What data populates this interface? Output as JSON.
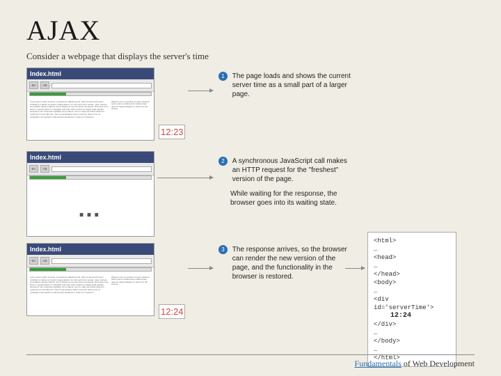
{
  "title": "AJAX",
  "subtitle": "Consider a webpage that displays the server's time",
  "browserTitle": "Index.html",
  "time1": "12:23",
  "time2": "12:24",
  "ellipsis": "…",
  "lorem": "Lorem ipsum dolor sit amet, consectetur adipiscing elit. Sed do eiusmod tempor incididunt ut labore et dolore magna aliqua. Ut enim ad minim veniam, quis nostrud exercitation ullamco laboris nisi ut aliquip ex ea commodo consequat. Duis aute irure dolor in reprehenderit in voluptate velit esse cillum dolore eu fugiat nulla pariatur. Excepteur sint occaecat cupidatat non proident, sunt in culpa qui officia deserunt mollit anim id est laborum. Sed ut perspiciatis unde omnis iste natus error sit voluptatem accusantium doloremque laudantium, totam rem aperiam.",
  "sidetext": "aliquam nunc sed tellus et lorem eleifend sed a purus condimentum ullamcorper quis ac magna aliquam et dolor nec elit viverra.",
  "callouts": {
    "c1": {
      "num": "1",
      "text": "The page loads and shows the current server time as a small part of a larger page."
    },
    "c2": {
      "num": "2",
      "text": "A synchronous JavaScript call makes an HTTP request for the \"freshest\" version of the page.",
      "sub": "While waiting for the response, the browser goes into its waiting state."
    },
    "c3": {
      "num": "3",
      "text": "The response arrives, so the browser can render the new version of the page, and the functionality in the browser is restored."
    }
  },
  "code": {
    "lines": [
      "<html>",
      "…",
      "<head>",
      "…",
      "</head>",
      "<body>",
      "…",
      "<div id='serverTime'>"
    ],
    "timeval": "12:24",
    "lines2": [
      "</div>",
      "…",
      "</body>",
      "…",
      "</html>"
    ]
  },
  "footer": {
    "a": "Fundamentals",
    "b": " of Web Development"
  }
}
